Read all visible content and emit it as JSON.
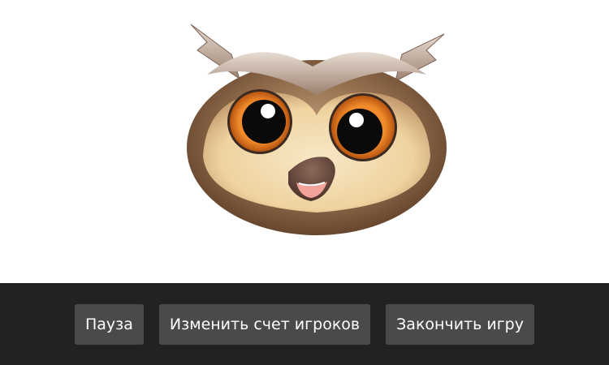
{
  "mascot": {
    "icon": "owl-icon",
    "colors": {
      "feather_dark": "#6b4a33",
      "feather_mid": "#a07a58",
      "face_light": "#f3dcae",
      "eye_ring": "#e8781e",
      "beak": "#6a4a3c"
    }
  },
  "controls": {
    "pause_label": "Пауза",
    "change_score_label": "Изменить счет игроков",
    "end_game_label": "Закончить игру"
  },
  "colors": {
    "toolbar_bg": "#222222",
    "button_bg": "#4a4a4a",
    "button_text": "#ffffff"
  }
}
